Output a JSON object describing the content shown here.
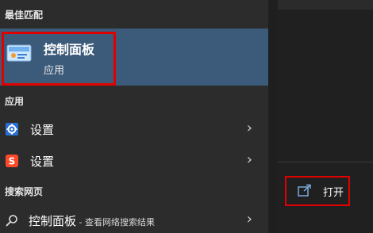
{
  "sections": {
    "best_match": "最佳匹配",
    "apps": "应用",
    "web_search": "搜索网页"
  },
  "best_match": {
    "title": "控制面板",
    "subtitle": "应用",
    "icon": "control-panel-icon"
  },
  "apps": [
    {
      "label": "设置",
      "icon": "gear-icon"
    },
    {
      "label": "设置",
      "icon": "sogou-icon"
    }
  ],
  "web_search": {
    "term": "控制面板",
    "hint": " - 查看网络搜索结果",
    "icon": "search-icon"
  },
  "actions": {
    "open_label": "打开",
    "icon": "open-icon"
  },
  "colors": {
    "selected_bg": "#3c5a7a",
    "highlight_border": "#e00000",
    "gear_accent": "#4aa0ff",
    "sogou_accent": "#ff4a2a"
  }
}
